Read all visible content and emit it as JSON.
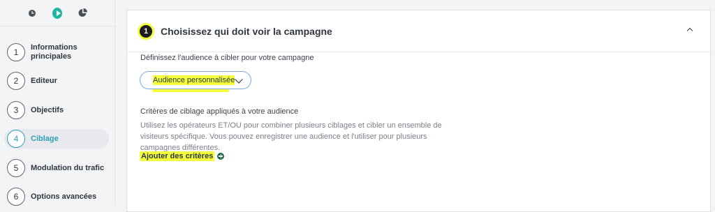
{
  "sidebar": {
    "top_icons": [
      "clock-icon",
      "play-icon",
      "pie-chart-icon"
    ],
    "steps": [
      {
        "number": "1",
        "label": "Informations principales"
      },
      {
        "number": "2",
        "label": "Editeur"
      },
      {
        "number": "3",
        "label": "Objectifs"
      },
      {
        "number": "4",
        "label": "Ciblage",
        "active": true
      },
      {
        "number": "5",
        "label": "Modulation du trafic"
      },
      {
        "number": "6",
        "label": "Options avancées"
      }
    ]
  },
  "card": {
    "step_number": "1",
    "title": "Choisissez qui doit voir la campagne",
    "lead": "Définissez l'audience à cibler pour votre campagne",
    "select": {
      "value": "Audience personnalisée"
    },
    "criteria_title": "Critères de ciblage appliqués à votre audience",
    "criteria_desc": "Utilisez les opérateurs ET/OU pour combiner plusieurs ciblages et cibler un ensemble de visiteurs spécifique. Vous pouvez enregistrer une audience et l'utiliser pour plusieurs campagnes différentes.",
    "add_label": "Ajouter des critères"
  },
  "colors": {
    "accent": "#2e9fb3",
    "highlight": "#f2ff3a",
    "play": "#1fb6a0"
  }
}
